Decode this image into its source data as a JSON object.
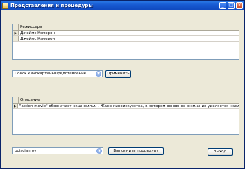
{
  "window": {
    "title": "Представления и процедуры"
  },
  "directors_grid": {
    "column": "Режиссеры",
    "rows": [
      "Джеймс Кэмерон",
      "Джеймс Кэмерон"
    ]
  },
  "view_combo": {
    "value": "Поиск кинокартиныПредставление"
  },
  "apply_button": {
    "label": "Применить"
  },
  "description_grid": {
    "column": "Описание",
    "rows": [
      "\"action movie\" обозначает экшнфильм . Жанр киноискусства, в котором основное внимание уделяется насилию, перестрелка"
    ]
  },
  "proc_combo": {
    "value": "poiscjanrov"
  },
  "execute_button": {
    "label": "Выполнить процедуру"
  },
  "exit_button": {
    "label": "Выход"
  }
}
